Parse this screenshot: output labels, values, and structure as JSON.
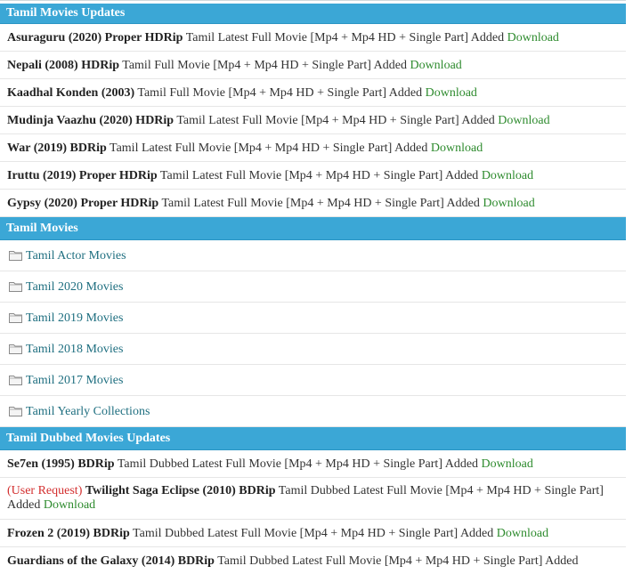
{
  "sections": {
    "updates": {
      "title": "Tamil Movies Updates",
      "items": [
        {
          "title": "Asuraguru (2020) Proper HDRip",
          "desc": "Tamil Latest Full Movie [Mp4 + Mp4 HD + Single Part] Added",
          "link": "Download"
        },
        {
          "title": "Nepali (2008) HDRip",
          "desc": "Tamil Full Movie [Mp4 + Mp4 HD + Single Part] Added",
          "link": "Download"
        },
        {
          "title": "Kaadhal Konden (2003)",
          "desc": "Tamil Full Movie [Mp4 + Mp4 HD + Single Part] Added",
          "link": "Download"
        },
        {
          "title": "Mudinja Vaazhu (2020) HDRip",
          "desc": "Tamil Latest Full Movie [Mp4 + Mp4 HD + Single Part] Added",
          "link": "Download"
        },
        {
          "title": "War (2019) BDRip",
          "desc": "Tamil Latest Full Movie [Mp4 + Mp4 HD + Single Part] Added",
          "link": "Download"
        },
        {
          "title": "Iruttu (2019) Proper HDRip",
          "desc": "Tamil Latest Full Movie [Mp4 + Mp4 HD + Single Part] Added",
          "link": "Download"
        },
        {
          "title": "Gypsy (2020) Proper HDRip",
          "desc": "Tamil Latest Full Movie [Mp4 + Mp4 HD + Single Part] Added",
          "link": "Download"
        }
      ]
    },
    "movies": {
      "title": "Tamil Movies",
      "items": [
        {
          "label": "Tamil Actor Movies"
        },
        {
          "label": "Tamil 2020 Movies"
        },
        {
          "label": "Tamil 2019 Movies"
        },
        {
          "label": "Tamil 2018 Movies"
        },
        {
          "label": "Tamil 2017 Movies"
        },
        {
          "label": "Tamil Yearly Collections"
        }
      ]
    },
    "dubbed": {
      "title": "Tamil Dubbed Movies Updates",
      "items": [
        {
          "prefix": "",
          "title": "Se7en (1995) BDRip",
          "desc": "Tamil Dubbed Latest Full Movie [Mp4 + Mp4 HD + Single Part] Added",
          "link": "Download"
        },
        {
          "prefix": "(User Request)",
          "title": "Twilight Saga Eclipse (2010) BDRip",
          "desc": "Tamil Dubbed Latest Full Movie [Mp4 + Mp4 HD + Single Part] Added",
          "link": "Download"
        },
        {
          "prefix": "",
          "title": "Frozen 2 (2019) BDRip",
          "desc": "Tamil Dubbed Latest Full Movie [Mp4 + Mp4 HD + Single Part] Added",
          "link": "Download"
        },
        {
          "prefix": "",
          "title": "Guardians of the Galaxy (2014) BDRip",
          "desc": "Tamil Dubbed Latest Full Movie [Mp4 + Mp4 HD + Single Part] Added",
          "link": ""
        }
      ]
    }
  },
  "icons": {
    "folder": "folder-icon"
  },
  "colors": {
    "header_bg": "#3ba7d6",
    "download_link": "#2e8b2e",
    "category_link": "#1f6f80",
    "request_tag": "#d32f2f"
  }
}
